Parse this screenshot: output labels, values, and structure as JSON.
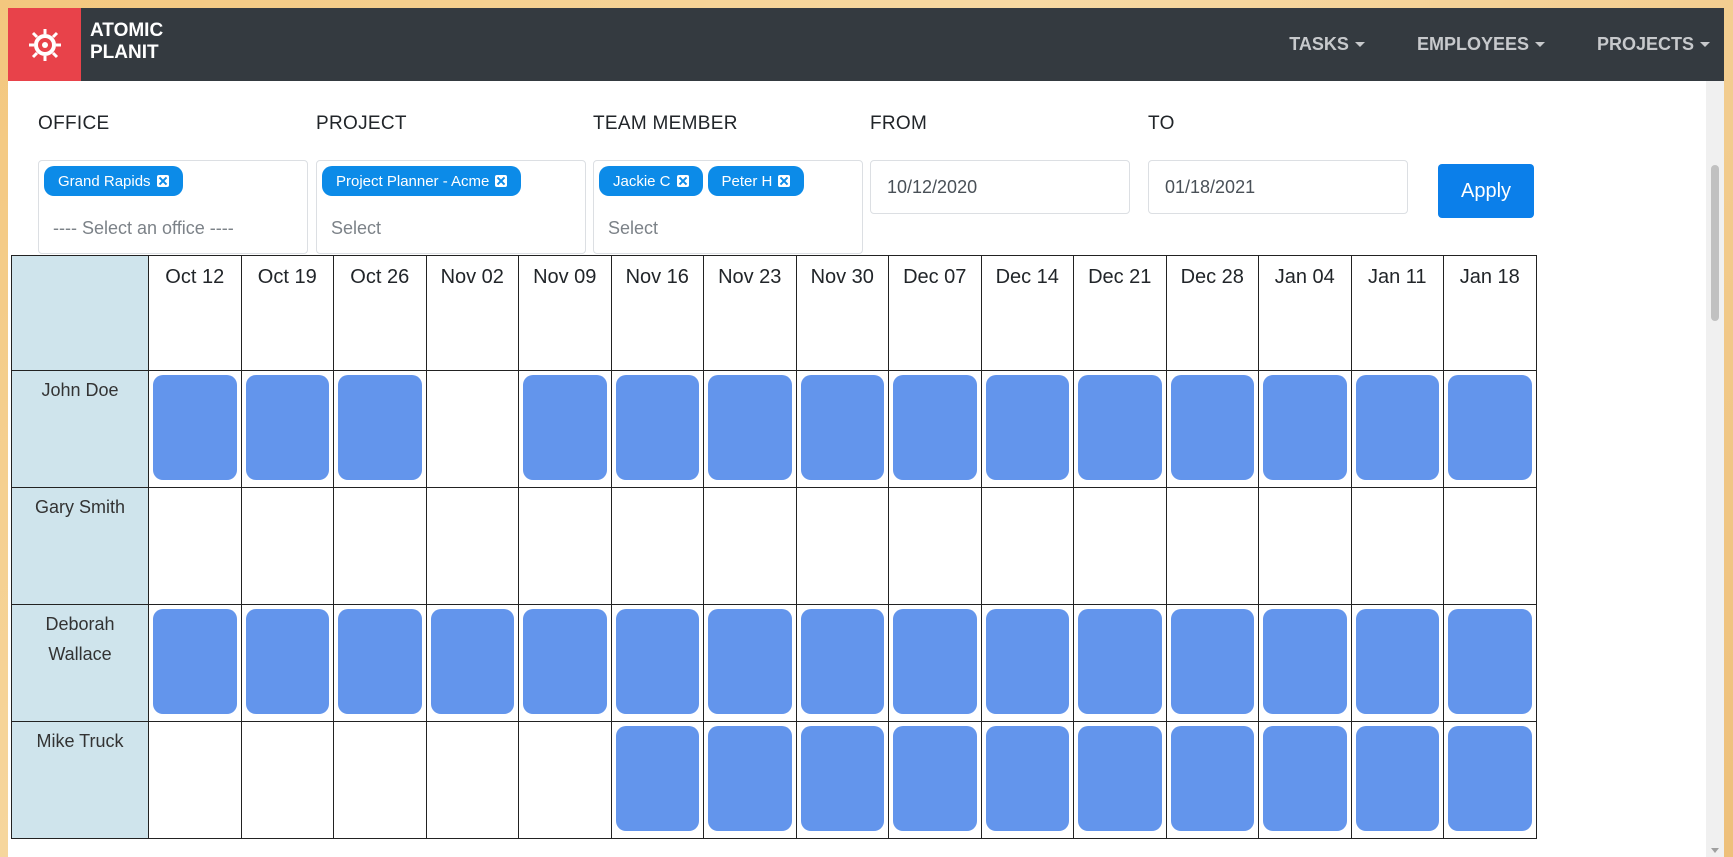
{
  "brand": {
    "line1": "ATOMIC",
    "line2": "PLANIT"
  },
  "nav": [
    {
      "label": "TASKS"
    },
    {
      "label": "EMPLOYEES"
    },
    {
      "label": "PROJECTS"
    }
  ],
  "filters": {
    "office": {
      "label": "OFFICE",
      "tags": [
        "Grand Rapids"
      ],
      "placeholder": "---- Select an office ----"
    },
    "project": {
      "label": "PROJECT",
      "tags": [
        "Project Planner - Acme"
      ],
      "placeholder": "Select"
    },
    "team": {
      "label": "TEAM MEMBER",
      "tags": [
        "Jackie C",
        "Peter H"
      ],
      "placeholder": "Select"
    },
    "from": {
      "label": "FROM",
      "value": "10/12/2020"
    },
    "to": {
      "label": "TO",
      "value": "01/18/2021"
    },
    "apply_label": "Apply"
  },
  "weeks": [
    "Oct 12",
    "Oct 19",
    "Oct 26",
    "Nov 02",
    "Nov 09",
    "Nov 16",
    "Nov 23",
    "Nov 30",
    "Dec 07",
    "Dec 14",
    "Dec 21",
    "Dec 28",
    "Jan 04",
    "Jan 11",
    "Jan 18"
  ],
  "employees": [
    {
      "name": "John Doe",
      "booked": [
        1,
        1,
        1,
        0,
        1,
        1,
        1,
        1,
        1,
        1,
        1,
        1,
        1,
        1,
        1
      ]
    },
    {
      "name": "Gary Smith",
      "booked": [
        0,
        0,
        0,
        0,
        0,
        0,
        0,
        0,
        0,
        0,
        0,
        0,
        0,
        0,
        0
      ]
    },
    {
      "name": "Deborah Wallace",
      "booked": [
        1,
        1,
        1,
        1,
        1,
        1,
        1,
        1,
        1,
        1,
        1,
        1,
        1,
        1,
        1
      ]
    },
    {
      "name": "Mike Truck",
      "booked": [
        0,
        0,
        0,
        0,
        0,
        1,
        1,
        1,
        1,
        1,
        1,
        1,
        1,
        1,
        1
      ]
    }
  ],
  "colors": {
    "navbar": "#343a40",
    "brand": "#e8424a",
    "tag": "#0c8be8",
    "block": "#6395ec",
    "name_col": "#cfe4ec"
  },
  "icons": {
    "logo": "atom-logo-icon",
    "caret": "caret-down-icon",
    "tag_remove": "close-icon"
  }
}
